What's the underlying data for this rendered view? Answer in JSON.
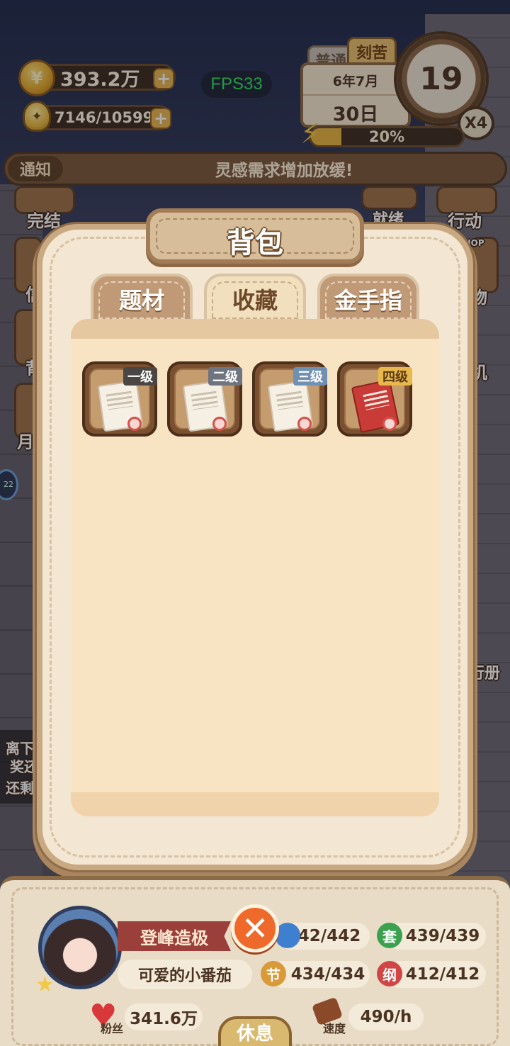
{
  "hud": {
    "coins": "393.2万",
    "inspiration": "7146/10599",
    "fps": "FPS33",
    "mode_normal": "普通",
    "mode_hard": "刻苦",
    "year_month": "6年7月",
    "day": "30日",
    "clock_number": "19",
    "speed_multiplier": "X4",
    "energy_percent": "20%",
    "energy_fraction": 0.2
  },
  "notice": {
    "tag": "通知",
    "text": "灵感需求增加放缓!"
  },
  "side_buttons": {
    "left_top": "完结",
    "right_top": "行动",
    "center_top": "就绪",
    "left_2": "信",
    "left_3": "背",
    "left_4": "月",
    "right_2": "物",
    "right_3": "机",
    "right_shop": "SHOP",
    "right_book": "行册",
    "offline_1": "离下",
    "offline_2": "奖还",
    "offline_3": "还剩",
    "timer_badge": "22"
  },
  "modal": {
    "title": "背包",
    "tabs": [
      {
        "label": "题材",
        "active": false
      },
      {
        "label": "收藏",
        "active": true
      },
      {
        "label": "金手指",
        "active": false
      }
    ],
    "items": [
      {
        "level": "一级",
        "icon": "paper-contract-icon"
      },
      {
        "level": "二级",
        "icon": "scroll-contract-icon"
      },
      {
        "level": "三级",
        "icon": "sealed-contract-icon"
      },
      {
        "level": "四级",
        "icon": "red-contract-icon"
      }
    ]
  },
  "profile": {
    "title": "登峰造极",
    "nickname": "可爱的小番茄",
    "stats": [
      {
        "badge": "",
        "value": "442/442",
        "color": "#3f7fd0"
      },
      {
        "badge": "套",
        "value": "439/439",
        "color": "#3aa14f"
      },
      {
        "badge": "节",
        "value": "434/434",
        "color": "#d99a3a"
      },
      {
        "badge": "纲",
        "value": "412/412",
        "color": "#d04545"
      }
    ],
    "fans_label": "粉丝",
    "fans": "341.6万",
    "speed_label": "速度",
    "speed": "490/h",
    "rest_button": "休息"
  }
}
